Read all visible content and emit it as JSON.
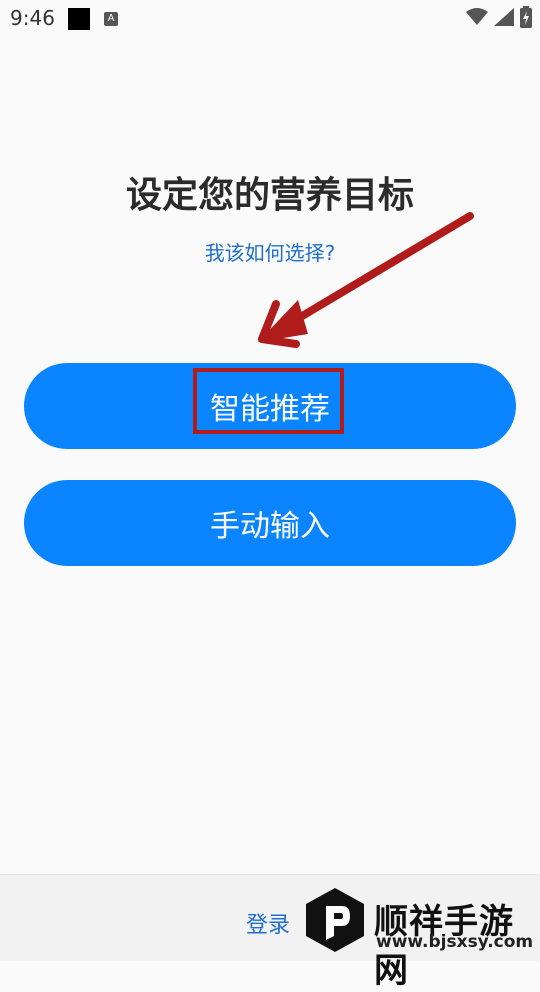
{
  "status_bar": {
    "time": "9:46",
    "icons": [
      "black-square-icon",
      "a-icon",
      "wifi-icon",
      "signal-icon",
      "battery-charging-icon"
    ]
  },
  "page": {
    "title": "设定您的营养目标",
    "help_link": "我该如何选择?"
  },
  "buttons": {
    "smart": "智能推荐",
    "manual": "手动输入"
  },
  "footer": {
    "login": "登录"
  },
  "watermark": {
    "name": "顺祥手游网",
    "url": "www.bjsxsy.com"
  },
  "colors": {
    "primary": "#0a84ff",
    "link": "#1e6fd0",
    "annotation": "#b01c1c"
  }
}
